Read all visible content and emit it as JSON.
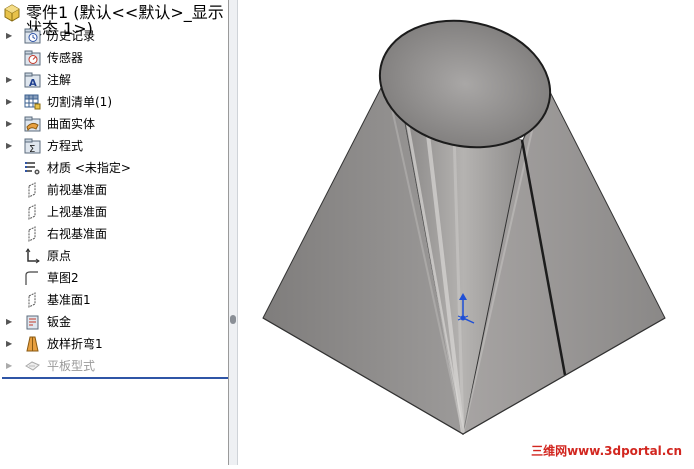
{
  "feature_tree": {
    "root": {
      "label": "零件1  (默认<<默认>_显示状态 1>)",
      "icon": "part-icon"
    },
    "items": [
      {
        "label": "历史记录",
        "icon": "history-folder-icon",
        "expandable": true
      },
      {
        "label": "传感器",
        "icon": "sensor-folder-icon",
        "expandable": false
      },
      {
        "label": "注解",
        "icon": "annotations-folder-icon",
        "expandable": true
      },
      {
        "label": "切割清单(1)",
        "icon": "cut-list-icon",
        "expandable": true
      },
      {
        "label": "曲面实体",
        "icon": "surface-bodies-folder-icon",
        "expandable": true
      },
      {
        "label": "方程式",
        "icon": "equations-folder-icon",
        "expandable": true
      },
      {
        "label": "材质 <未指定>",
        "icon": "material-icon",
        "expandable": false
      },
      {
        "label": "前视基准面",
        "icon": "plane-icon",
        "expandable": false
      },
      {
        "label": "上视基准面",
        "icon": "plane-icon",
        "expandable": false
      },
      {
        "label": "右视基准面",
        "icon": "plane-icon",
        "expandable": false
      },
      {
        "label": "原点",
        "icon": "origin-icon",
        "expandable": false
      },
      {
        "label": "草图2",
        "icon": "sketch-icon",
        "expandable": false
      },
      {
        "label": "基准面1",
        "icon": "plane-icon",
        "expandable": false
      },
      {
        "label": "钣金",
        "icon": "sheet-metal-icon",
        "expandable": true
      },
      {
        "label": "放样折弯1",
        "icon": "lofted-bend-icon",
        "expandable": true
      },
      {
        "label": "平板型式",
        "icon": "flat-pattern-icon",
        "expandable": true,
        "suppressed": true
      }
    ]
  },
  "watermark": "三维网www.3dportal.cn",
  "colors": {
    "rollback_bar": "#2f55a6",
    "watermark": "#d2261f",
    "model_gray": "#8e8c8b"
  }
}
